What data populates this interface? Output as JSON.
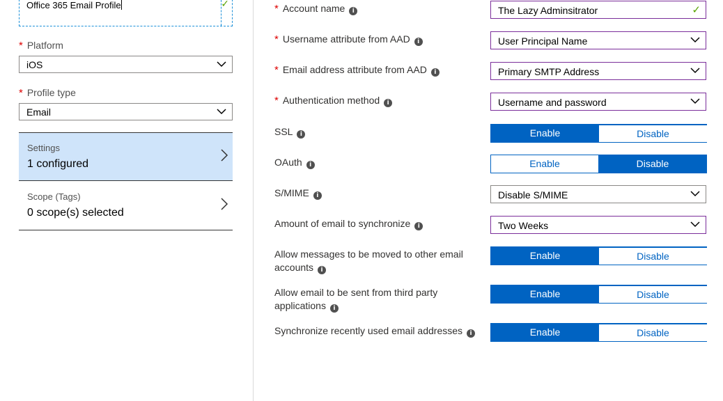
{
  "left": {
    "profile_name": "Office 365 Email Profile",
    "platform_label": "Platform",
    "platform_value": "iOS",
    "profile_type_label": "Profile type",
    "profile_type_value": "Email",
    "settings": {
      "title": "Settings",
      "value": "1 configured"
    },
    "scope": {
      "title": "Scope (Tags)",
      "value": "0 scope(s) selected"
    }
  },
  "form": {
    "account_name": {
      "label": "Account name",
      "value": "The Lazy Adminsitrator"
    },
    "username_attr": {
      "label": "Username attribute from AAD",
      "value": "User Principal Name"
    },
    "email_attr": {
      "label": "Email address attribute from AAD",
      "value": "Primary SMTP Address"
    },
    "auth_method": {
      "label": "Authentication method",
      "value": "Username and password"
    },
    "ssl": {
      "label": "SSL",
      "enable": "Enable",
      "disable": "Disable",
      "selected": "Enable"
    },
    "oauth": {
      "label": "OAuth",
      "enable": "Enable",
      "disable": "Disable",
      "selected": "Disable"
    },
    "smime": {
      "label": "S/MIME",
      "value": "Disable S/MIME"
    },
    "sync_amount": {
      "label": "Amount of email to synchronize",
      "value": "Two Weeks"
    },
    "move_messages": {
      "label_line1": "Allow messages to be moved to other email",
      "label_line2": "accounts",
      "enable": "Enable",
      "disable": "Disable",
      "selected": "Enable"
    },
    "third_party": {
      "label_line1": "Allow email to be sent from third party",
      "label_line2": "applications",
      "enable": "Enable",
      "disable": "Disable",
      "selected": "Enable"
    },
    "sync_recent": {
      "label": "Synchronize recently used email addresses",
      "enable": "Enable",
      "disable": "Disable",
      "selected": "Enable"
    }
  },
  "colors": {
    "accent": "#0063c2",
    "required": "#dd0000",
    "valid": "#57a300",
    "selected_nav": "#cfe4fa",
    "focus_border": "#7a2d9a"
  }
}
